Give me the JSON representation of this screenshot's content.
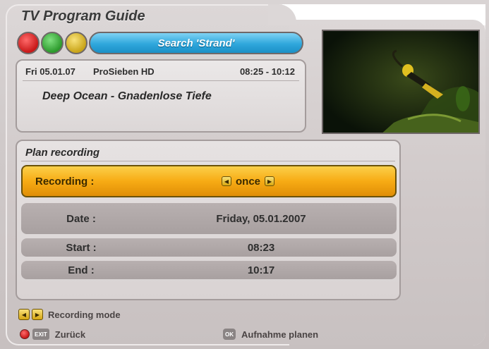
{
  "header": {
    "title": "TV Program Guide",
    "search_label": "Search 'Strand'"
  },
  "color_buttons": [
    "red",
    "green",
    "yellow",
    "blue"
  ],
  "epg": {
    "date": "Fri 05.01.07",
    "channel": "ProSieben HD",
    "time": "08:25 - 10:12",
    "program_title": "Deep Ocean - Gnadenlose Tiefe"
  },
  "plan": {
    "title": "Plan recording",
    "recording_label": "Recording :",
    "recording_value": "once",
    "date_label": "Date :",
    "date_value": "Friday, 05.01.2007",
    "start_label": "Start :",
    "start_value": "08:23",
    "end_label": "End :",
    "end_value": "10:17"
  },
  "footer": {
    "mode_label": "Recording mode",
    "exit_key": "EXIT",
    "back_label": "Zurück",
    "ok_key": "OK",
    "ok_label": "Aufnahme planen"
  },
  "colors": {
    "highlight": "#f7ab14",
    "search": "#2fa7dc",
    "background": "#d6d1d1"
  }
}
